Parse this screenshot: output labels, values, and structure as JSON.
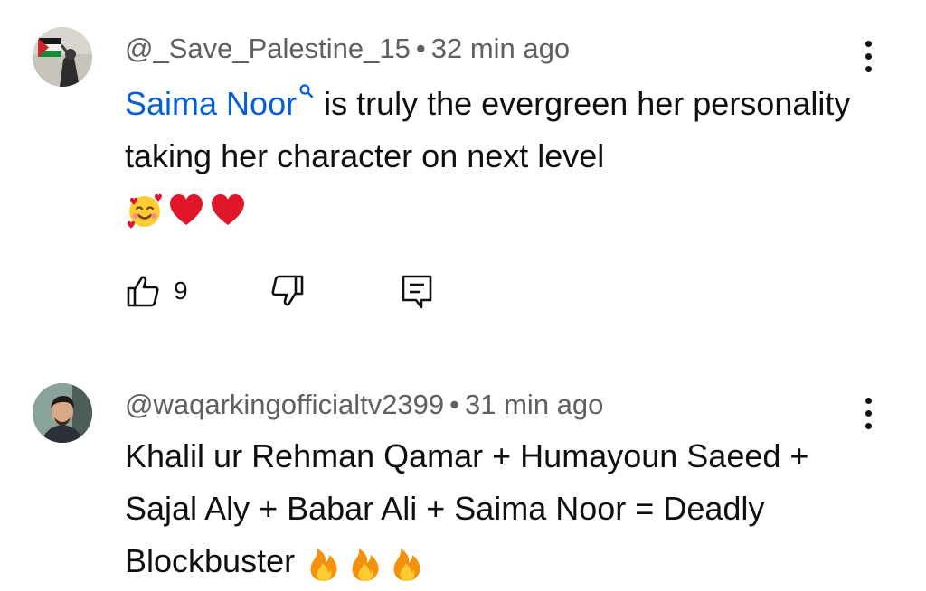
{
  "comments": [
    {
      "author": "@_Save_Palestine_15",
      "separator": "•",
      "time": "32 min ago",
      "mention": "Saima Noor",
      "text_after_mention": " is truly the evergreen her personality taking her character on next level",
      "emojis": [
        "smiling-face-with-hearts",
        "red-heart",
        "red-heart"
      ],
      "like_count": "9"
    },
    {
      "author": "@waqarkingofficialtv2399",
      "separator": "•",
      "time": "31 min ago",
      "text": "Khalil ur Rehman Qamar + Humayoun Saeed + Sajal Aly + Babar Ali + Saima Noor = Deadly Blockbuster",
      "emojis": [
        "fire",
        "fire",
        "fire"
      ]
    }
  ],
  "colors": {
    "text": "#0f0f0f",
    "meta": "#606060",
    "mention": "#065fd4",
    "heart": "#e0162b",
    "fire": "#f4900c"
  },
  "icons": [
    "thumbs-up-icon",
    "thumbs-down-icon",
    "reply-icon",
    "more-vert-icon",
    "search-icon"
  ]
}
